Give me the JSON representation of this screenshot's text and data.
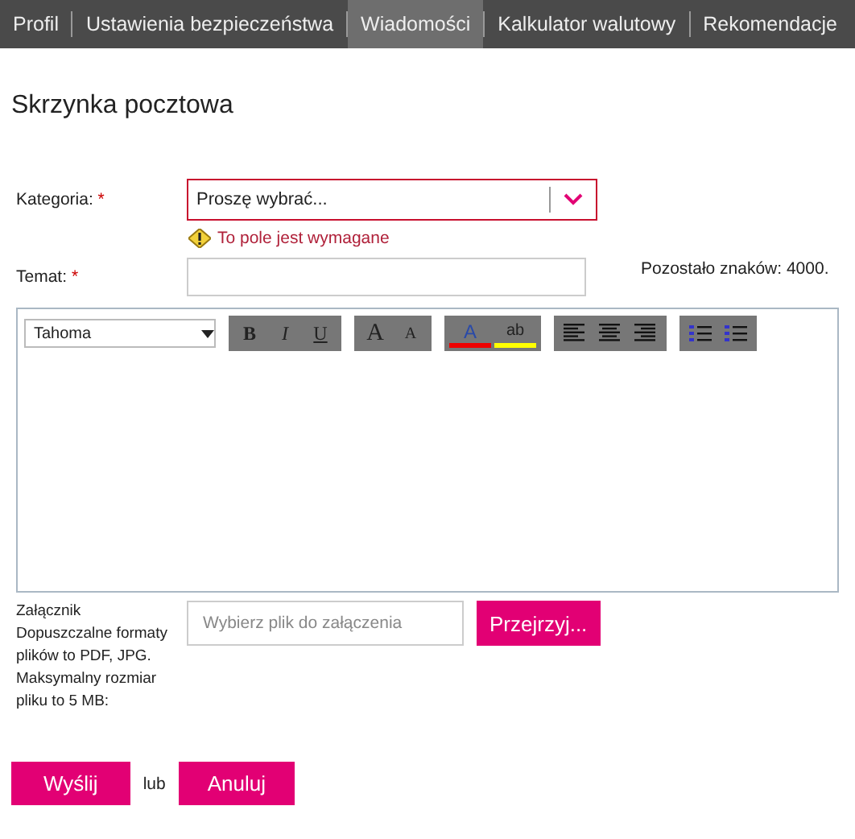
{
  "nav": {
    "tabs": [
      {
        "label": "Profil",
        "selected": false
      },
      {
        "label": "Ustawienia bezpieczeństwa",
        "selected": false
      },
      {
        "label": "Wiadomości",
        "selected": true
      },
      {
        "label": "Kalkulator walutowy",
        "selected": false
      },
      {
        "label": "Rekomendacje",
        "selected": false
      }
    ]
  },
  "title": "Skrzynka pocztowa",
  "category": {
    "label": "Kategoria:",
    "required_mark": "*",
    "value": "Proszę wybrać...",
    "error": "To pole jest wymagane"
  },
  "subject": {
    "label": "Temat:",
    "required_mark": "*",
    "counter": "Pozostało znaków: 4000."
  },
  "editor": {
    "font": "Tahoma",
    "groups": [
      [
        {
          "kind": "bold",
          "label": "B"
        },
        {
          "kind": "italic",
          "label": "I"
        },
        {
          "kind": "underline",
          "label": "U"
        }
      ],
      [
        {
          "kind": "grow",
          "label": "A"
        },
        {
          "kind": "shrink",
          "label": "A"
        }
      ],
      [
        {
          "kind": "fontcolor",
          "label": "A"
        },
        {
          "kind": "highlight",
          "label": "ab"
        }
      ],
      [
        {
          "kind": "align-left"
        },
        {
          "kind": "align-center"
        },
        {
          "kind": "align-right"
        }
      ],
      [
        {
          "kind": "numbered-list"
        },
        {
          "kind": "bullet-list"
        }
      ]
    ]
  },
  "attachment": {
    "label": "Załącznik Dopuszczalne formaty plików to PDF, JPG. Maksymalny rozmiar pliku to 5 MB:",
    "placeholder": "Wybierz plik do załączenia",
    "browse": "Przejrzyj..."
  },
  "actions": {
    "send": "Wyślij",
    "separator": "lub",
    "cancel": "Anuluj"
  }
}
